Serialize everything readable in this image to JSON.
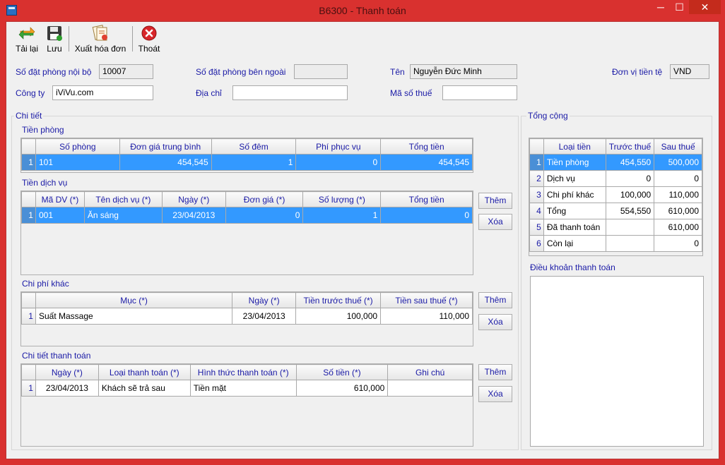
{
  "window": {
    "title": "B6300 - Thanh toán",
    "min_glyph": "─",
    "max_glyph": "☐",
    "close_glyph": "✕"
  },
  "toolbar": {
    "reload_label": "Tải lại",
    "save_label": "Lưu",
    "invoice_label": "Xuất hóa đơn",
    "exit_label": "Thoát"
  },
  "header": {
    "internal_booking_label": "Số đặt phòng nội bộ",
    "internal_booking_value": "10007",
    "external_booking_label": "Số đặt phòng bên ngoài",
    "external_booking_value": "",
    "name_label": "Tên",
    "name_value": "Nguyễn Đức Minh",
    "currency_label": "Đơn vị tiền tệ",
    "currency_value": "VND",
    "company_label": "Công ty",
    "company_value": "iViVu.com",
    "address_label": "Địa chỉ",
    "address_value": "",
    "tax_label": "Mã số thuế",
    "tax_value": ""
  },
  "detail": {
    "group_title": "Chi tiết",
    "room": {
      "title": "Tiền phòng",
      "columns": [
        "Số phòng",
        "Đơn giá trung bình",
        "Số đêm",
        "Phí phục vụ",
        "Tổng tiền"
      ],
      "rows": [
        {
          "idx": "1",
          "cells": [
            "101",
            "454,545",
            "1",
            "0",
            "454,545"
          ]
        }
      ]
    },
    "service": {
      "title": "Tiền dịch vụ",
      "columns": [
        "Mã DV (*)",
        "Tên dịch vụ (*)",
        "Ngày (*)",
        "Đơn giá (*)",
        "Số lượng (*)",
        "Tổng tiền"
      ],
      "rows": [
        {
          "idx": "1",
          "cells": [
            "001",
            "Ăn sáng",
            "23/04/2013",
            "0",
            "1",
            "0"
          ]
        }
      ],
      "add_label": "Thêm",
      "delete_label": "Xóa"
    },
    "other": {
      "title": "Chi phí khác",
      "columns": [
        "Mục (*)",
        "Ngày (*)",
        "Tiền trước thuế (*)",
        "Tiền sau thuế (*)"
      ],
      "rows": [
        {
          "idx": "1",
          "cells": [
            "Suất Massage",
            "23/04/2013",
            "100,000",
            "110,000"
          ]
        }
      ],
      "add_label": "Thêm",
      "delete_label": "Xóa"
    },
    "payment": {
      "title": "Chi tiết thanh toán",
      "columns": [
        "Ngày (*)",
        "Loại thanh toán (*)",
        "Hình thức thanh toán (*)",
        "Số tiền (*)",
        "Ghi chú"
      ],
      "rows": [
        {
          "idx": "1",
          "cells": [
            "23/04/2013",
            "Khách sẽ trả sau",
            "Tiền mặt",
            "610,000",
            ""
          ]
        }
      ],
      "add_label": "Thêm",
      "delete_label": "Xóa"
    }
  },
  "summary": {
    "group_title": "Tổng cộng",
    "columns": [
      "Loại tiền",
      "Trước thuế",
      "Sau thuế"
    ],
    "rows": [
      {
        "idx": "1",
        "cells": [
          "Tiền phòng",
          "454,550",
          "500,000"
        ]
      },
      {
        "idx": "2",
        "cells": [
          "Dịch vụ",
          "0",
          "0"
        ]
      },
      {
        "idx": "3",
        "cells": [
          "Chi phí khác",
          "100,000",
          "110,000"
        ]
      },
      {
        "idx": "4",
        "cells": [
          "Tổng",
          "554,550",
          "610,000"
        ]
      },
      {
        "idx": "5",
        "cells": [
          "Đã thanh toán",
          "",
          "610,000"
        ]
      },
      {
        "idx": "6",
        "cells": [
          "Còn lại",
          "",
          "0"
        ]
      }
    ],
    "terms_label": "Điều khoản thanh toán",
    "terms_value": ""
  }
}
